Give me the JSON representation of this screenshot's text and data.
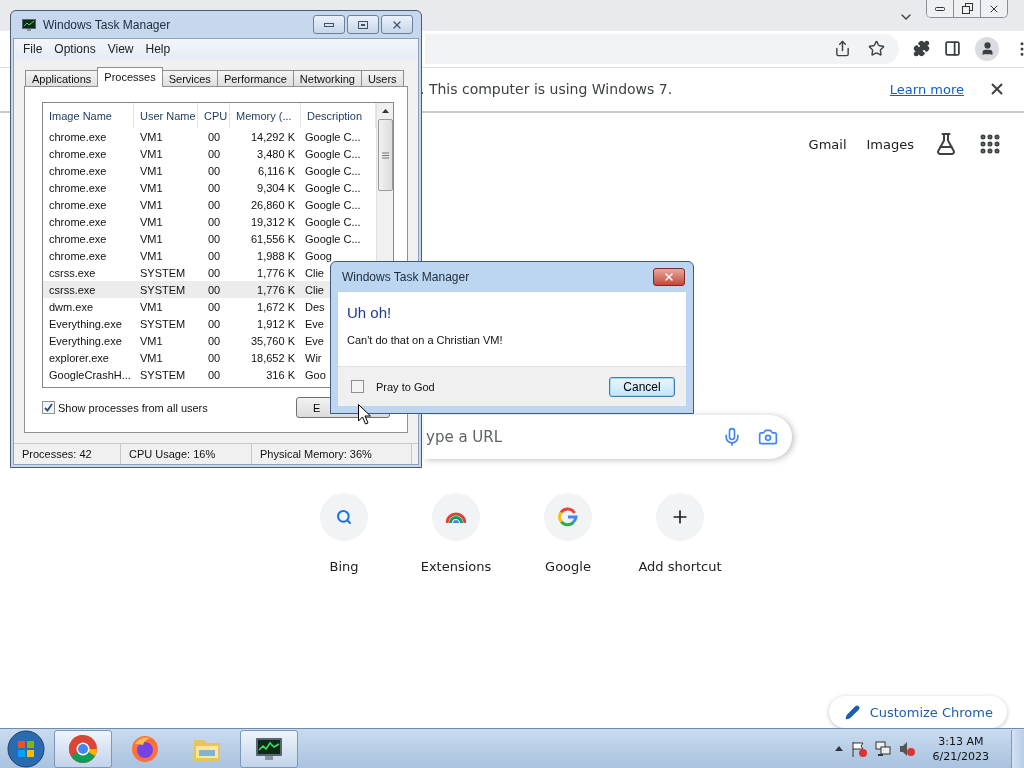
{
  "browser": {
    "infobar": {
      "message": ". This computer is using Windows 7.",
      "link": "Learn more"
    },
    "header_links": [
      "Gmail",
      "Images"
    ],
    "search": {
      "placeholder": "ype a URL"
    },
    "shortcuts": [
      {
        "label": "Bing",
        "kind": "search"
      },
      {
        "label": "Extensions",
        "kind": "extensions"
      },
      {
        "label": "Google",
        "kind": "google"
      },
      {
        "label": "Add shortcut",
        "kind": "add"
      }
    ],
    "customize_button": "Customize Chrome"
  },
  "task_manager": {
    "title": "Windows Task Manager",
    "menu": [
      "File",
      "Options",
      "View",
      "Help"
    ],
    "tabs": [
      {
        "label": "Applications",
        "selected": false
      },
      {
        "label": "Processes",
        "selected": true
      },
      {
        "label": "Services",
        "selected": false
      },
      {
        "label": "Performance",
        "selected": false
      },
      {
        "label": "Networking",
        "selected": false
      },
      {
        "label": "Users",
        "selected": false
      }
    ],
    "table": {
      "columns": [
        "Image Name",
        "User Name",
        "CPU",
        "Memory (...",
        "Description"
      ],
      "rows": [
        {
          "cells": [
            "chrome.exe",
            "VM1",
            "00",
            "14,292 K",
            "Google C..."
          ],
          "selected": false
        },
        {
          "cells": [
            "chrome.exe",
            "VM1",
            "00",
            "3,480 K",
            "Google C..."
          ],
          "selected": false
        },
        {
          "cells": [
            "chrome.exe",
            "VM1",
            "00",
            "6,116 K",
            "Google C..."
          ],
          "selected": false
        },
        {
          "cells": [
            "chrome.exe",
            "VM1",
            "00",
            "9,304 K",
            "Google C..."
          ],
          "selected": false
        },
        {
          "cells": [
            "chrome.exe",
            "VM1",
            "00",
            "26,860 K",
            "Google C..."
          ],
          "selected": false
        },
        {
          "cells": [
            "chrome.exe",
            "VM1",
            "00",
            "19,312 K",
            "Google C..."
          ],
          "selected": false
        },
        {
          "cells": [
            "chrome.exe",
            "VM1",
            "00",
            "61,556 K",
            "Google C..."
          ],
          "selected": false
        },
        {
          "cells": [
            "chrome.exe",
            "VM1",
            "00",
            "1,988 K",
            "Goog"
          ],
          "selected": false
        },
        {
          "cells": [
            "csrss.exe",
            "SYSTEM",
            "00",
            "1,776 K",
            "Clie"
          ],
          "selected": false
        },
        {
          "cells": [
            "csrss.exe",
            "SYSTEM",
            "00",
            "1,776 K",
            "Clie"
          ],
          "selected": true
        },
        {
          "cells": [
            "dwm.exe",
            "VM1",
            "00",
            "1,672 K",
            "Des"
          ],
          "selected": false
        },
        {
          "cells": [
            "Everything.exe",
            "SYSTEM",
            "00",
            "1,912 K",
            "Eve"
          ],
          "selected": false
        },
        {
          "cells": [
            "Everything.exe",
            "VM1",
            "00",
            "35,760 K",
            "Eve"
          ],
          "selected": false
        },
        {
          "cells": [
            "explorer.exe",
            "VM1",
            "00",
            "18,652 K",
            "Wir"
          ],
          "selected": false
        },
        {
          "cells": [
            "GoogleCrashH...",
            "SYSTEM",
            "00",
            "316 K",
            "Goo"
          ],
          "selected": false
        }
      ]
    },
    "show_all_users": {
      "label": "Show processes from all users",
      "checked": true
    },
    "end_button": "E",
    "status_bar": [
      "Processes: 42",
      "CPU Usage: 16%",
      "Physical Memory: 36%"
    ]
  },
  "dialog": {
    "title": "Windows Task Manager",
    "heading": "Uh oh!",
    "message": "Can't do that on a Christian VM!",
    "checkbox": {
      "label": "Pray to God",
      "checked": false
    },
    "button": "Cancel"
  },
  "taskbar": {
    "apps": [
      {
        "kind": "chrome",
        "active": true
      },
      {
        "kind": "firefox",
        "active": false
      },
      {
        "kind": "explorer",
        "active": false
      },
      {
        "kind": "taskmgr",
        "active": true
      }
    ],
    "clock": {
      "time": "3:13 AM",
      "date": "6/21/2023"
    }
  }
}
